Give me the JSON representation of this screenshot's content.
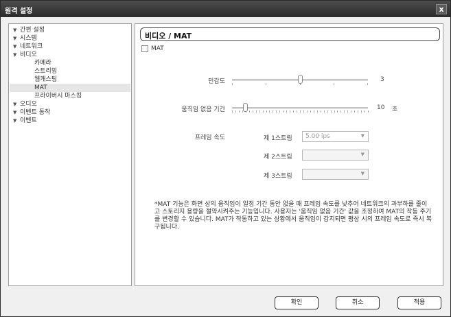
{
  "window": {
    "title": "원격 설정",
    "close_label": "x"
  },
  "tree": {
    "items": [
      {
        "label": "간편 설정",
        "arrow": "▼"
      },
      {
        "label": "시스템",
        "arrow": "▼"
      },
      {
        "label": "네트워크",
        "arrow": "▼"
      },
      {
        "label": "비디오",
        "arrow": "▼"
      },
      {
        "label": "카메라",
        "arrow": ""
      },
      {
        "label": "스트리밍",
        "arrow": ""
      },
      {
        "label": "웹캐스팅",
        "arrow": ""
      },
      {
        "label": "MAT",
        "arrow": ""
      },
      {
        "label": "프라이버시 마스킹",
        "arrow": ""
      },
      {
        "label": "오디오",
        "arrow": "▼"
      },
      {
        "label": "이벤트 동작",
        "arrow": "▼"
      },
      {
        "label": "이벤트",
        "arrow": "▼"
      }
    ]
  },
  "content": {
    "section_title": "비디오 / MAT",
    "mat_checkbox_label": "MAT",
    "mat_checked": false,
    "sensitivity": {
      "label": "민감도",
      "value": "3",
      "level": 0.5
    },
    "no_motion": {
      "label": "움직임 없음 기간",
      "value": "10",
      "unit": "초",
      "level": 0.1
    },
    "frame_rate": {
      "label": "프레임 속도",
      "streams": [
        {
          "label": "제 1스트림",
          "value": "5.00 ips",
          "arrow": "▼"
        },
        {
          "label": "제 2스트림",
          "value": "",
          "arrow": "▼"
        },
        {
          "label": "제 3스트림",
          "value": "",
          "arrow": "▼"
        }
      ]
    },
    "note": "*MAT 기능은 화면 상의 움직임이 일정 기간 동안 없을 때 프레임 속도를 낮추어 네트워크의 과부하를 줄이고 스토리지 용량을 절약시켜주는 기능입니다. 사용자는 '움직임 없음 기간' 값을 조정하여 MAT의 작동 주기를 변경할 수 있습니다. MAT가 작동하고 있는 상황에서 움직임이 감지되면 평상 시의 프레임 속도로 즉시 복구됩니다."
  },
  "buttons": {
    "confirm": "확인",
    "cancel": "취소",
    "apply": "적용"
  }
}
